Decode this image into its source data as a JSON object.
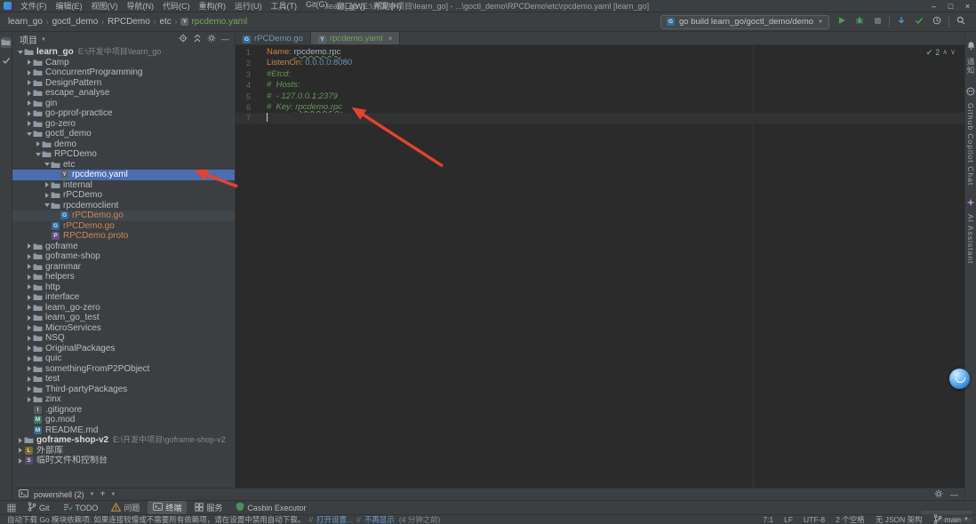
{
  "title_bar": {
    "menus": [
      "文件(F)",
      "编辑(E)",
      "视图(V)",
      "导航(N)",
      "代码(C)",
      "重构(R)",
      "运行(U)",
      "工具(T)",
      "Git(G)",
      "窗口(W)",
      "帮助(H)"
    ],
    "title": "learn_go [E:\\开发中项目\\learn_go] - ...\\goctl_demo\\RPCDemo\\etc\\rpcdemo.yaml [learn_go]",
    "window_buttons": [
      {
        "name": "minimize",
        "glyph": "–"
      },
      {
        "name": "maximize",
        "glyph": "□"
      },
      {
        "name": "close",
        "glyph": "×"
      }
    ]
  },
  "nav_bar": {
    "breadcrumbs": [
      "learn_go",
      "goctl_demo",
      "RPCDemo",
      "etc",
      "rpcdemo.yaml"
    ],
    "run_config": "go build learn_go/goctl_demo/demo",
    "toolbar_icons": [
      "run",
      "debug",
      "stop",
      "divider",
      "vcs-update",
      "vcs-commit",
      "history",
      "divider",
      "search"
    ]
  },
  "left_strip": {
    "buttons": [
      {
        "icon": "folder",
        "label": "project",
        "active": true
      },
      {
        "icon": "commit",
        "label": "commit",
        "active": false
      }
    ]
  },
  "right_strip": {
    "buttons": [
      {
        "icon": "bell",
        "label": "通知"
      },
      {
        "icon": "copilot",
        "label": "Github Copilot Chat"
      },
      {
        "icon": "ai-star",
        "label": "AI Assistant"
      }
    ]
  },
  "project_panel": {
    "title": "项目",
    "header_icons": [
      "locate",
      "collapse-all",
      "settings",
      "hide"
    ],
    "tree": [
      {
        "label": "learn_go",
        "ann": "E:\\开发中项目\\learn_go",
        "level": 0,
        "state": "expanded",
        "icon": "folder",
        "bold": true
      },
      {
        "label": "Camp",
        "level": 1,
        "state": "collapsed",
        "icon": "folder"
      },
      {
        "label": "ConcurrentProgramming",
        "level": 1,
        "state": "collapsed",
        "icon": "folder"
      },
      {
        "label": "DesignPattern",
        "level": 1,
        "state": "collapsed",
        "icon": "folder"
      },
      {
        "label": "escape_analyse",
        "level": 1,
        "state": "collapsed",
        "icon": "folder"
      },
      {
        "label": "gin",
        "level": 1,
        "state": "collapsed",
        "icon": "folder"
      },
      {
        "label": "go-pprof-practice",
        "level": 1,
        "state": "collapsed",
        "icon": "folder"
      },
      {
        "label": "go-zero",
        "level": 1,
        "state": "collapsed",
        "icon": "folder"
      },
      {
        "label": "goctl_demo",
        "level": 1,
        "state": "expanded",
        "icon": "folder"
      },
      {
        "label": "demo",
        "level": 2,
        "state": "collapsed",
        "icon": "folder"
      },
      {
        "label": "RPCDemo",
        "level": 2,
        "state": "expanded",
        "icon": "folder"
      },
      {
        "label": "etc",
        "level": 3,
        "state": "expanded",
        "icon": "folder"
      },
      {
        "label": "rpcdemo.yaml",
        "level": 4,
        "state": "leaf",
        "icon": "yaml",
        "bg": "selected",
        "color": "#ffffff"
      },
      {
        "label": "internal",
        "level": 3,
        "state": "collapsed",
        "icon": "folder"
      },
      {
        "label": "rPCDemo",
        "level": 3,
        "state": "collapsed",
        "icon": "folder"
      },
      {
        "label": "rpcdemoclient",
        "level": 3,
        "state": "expanded",
        "icon": "folder"
      },
      {
        "label": "rPCDemo.go",
        "level": 4,
        "state": "leaf",
        "icon": "go",
        "bg": "inactive",
        "color": "#c9885c"
      },
      {
        "label": "rPCDemo.go",
        "level": 3,
        "state": "leaf",
        "icon": "go",
        "color": "#c9885c"
      },
      {
        "label": "RPCDemo.proto",
        "level": 3,
        "state": "leaf",
        "icon": "proto",
        "color": "#c9885c"
      },
      {
        "label": "goframe",
        "level": 1,
        "state": "collapsed",
        "icon": "folder"
      },
      {
        "label": "goframe-shop",
        "level": 1,
        "state": "collapsed",
        "icon": "folder"
      },
      {
        "label": "grammar",
        "level": 1,
        "state": "collapsed",
        "icon": "folder"
      },
      {
        "label": "helpers",
        "level": 1,
        "state": "collapsed",
        "icon": "folder"
      },
      {
        "label": "http",
        "level": 1,
        "state": "collapsed",
        "icon": "folder"
      },
      {
        "label": "interface",
        "level": 1,
        "state": "collapsed",
        "icon": "folder"
      },
      {
        "label": "learn_go-zero",
        "level": 1,
        "state": "collapsed",
        "icon": "folder"
      },
      {
        "label": "learn_go_test",
        "level": 1,
        "state": "collapsed",
        "icon": "folder"
      },
      {
        "label": "MicroServices",
        "level": 1,
        "state": "collapsed",
        "icon": "folder"
      },
      {
        "label": "NSQ",
        "level": 1,
        "state": "collapsed",
        "icon": "folder"
      },
      {
        "label": "OriginalPackages",
        "level": 1,
        "state": "collapsed",
        "icon": "folder"
      },
      {
        "label": "quic",
        "level": 1,
        "state": "collapsed",
        "icon": "folder"
      },
      {
        "label": "somethingFromP2PObject",
        "level": 1,
        "state": "collapsed",
        "icon": "folder"
      },
      {
        "label": "test",
        "level": 1,
        "state": "collapsed",
        "icon": "folder"
      },
      {
        "label": "Third-partyPackages",
        "level": 1,
        "state": "collapsed",
        "icon": "folder"
      },
      {
        "label": "zinx",
        "level": 1,
        "state": "collapsed",
        "icon": "folder"
      },
      {
        "label": ".gitignore",
        "level": 1,
        "state": "leaf",
        "icon": "gitignore"
      },
      {
        "label": "go.mod",
        "level": 1,
        "state": "leaf",
        "icon": "gomod"
      },
      {
        "label": "README.md",
        "level": 1,
        "state": "leaf",
        "icon": "md"
      },
      {
        "label": "goframe-shop-v2",
        "ann": "E:\\开发中项目\\goframe-shop-v2",
        "level": 0,
        "state": "collapsed",
        "icon": "folder",
        "bold": true
      },
      {
        "label": "外部库",
        "level": 0,
        "state": "collapsed",
        "icon": "lib"
      },
      {
        "label": "临时文件和控制台",
        "level": 0,
        "state": "collapsed",
        "icon": "scratch"
      }
    ]
  },
  "editor": {
    "tabs": [
      {
        "label": "rPCDemo.go",
        "icon": "go",
        "color": "#6897bb",
        "active": false
      },
      {
        "label": "rpcdemo.yaml",
        "icon": "yaml",
        "color": "#73a25f",
        "active": true,
        "close": "×"
      }
    ],
    "inspection_count": "2",
    "lines": [
      {
        "no": "1",
        "tokens": [
          {
            "t": "Name:",
            "s": "key"
          },
          {
            "t": " ",
            "s": "plain"
          },
          {
            "t": "rpcdemo.rpc",
            "s": "plain underline"
          }
        ]
      },
      {
        "no": "2",
        "tokens": [
          {
            "t": "ListenOn:",
            "s": "key"
          },
          {
            "t": " ",
            "s": "plain"
          },
          {
            "t": "0.0.0.0:8080",
            "s": "num"
          }
        ]
      },
      {
        "no": "3",
        "tokens": [
          {
            "t": "#Etcd:",
            "s": "comment"
          }
        ]
      },
      {
        "no": "4",
        "tokens": [
          {
            "t": "#  Hosts:",
            "s": "comment"
          }
        ]
      },
      {
        "no": "5",
        "tokens": [
          {
            "t": "#  - 127.0.0.1:2379",
            "s": "comment"
          }
        ]
      },
      {
        "no": "6",
        "tokens": [
          {
            "t": "#  Key: ",
            "s": "comment"
          },
          {
            "t": "rpcdemo.rpc",
            "s": "comment underline"
          }
        ]
      },
      {
        "no": "7",
        "tokens": [],
        "caret": true
      }
    ]
  },
  "terminal_bar": {
    "tab_label": "powershell (2)",
    "new_tab": "+",
    "right_icons": [
      "settings",
      "minimize"
    ]
  },
  "tool_window_bar": {
    "items": [
      {
        "label": "Git",
        "icon": "git-branch",
        "active": false
      },
      {
        "label": "TODO",
        "icon": "todo",
        "active": false
      },
      {
        "label": "问题",
        "icon": "problems",
        "active": false
      },
      {
        "label": "终端",
        "icon": "terminal",
        "active": true
      },
      {
        "label": "服务",
        "icon": "services",
        "active": false
      },
      {
        "label": "Casbin Executor",
        "icon": "casbin",
        "active": false
      }
    ]
  },
  "status_bar": {
    "message": "自动下载 Go 模块依赖项: 如果连接较慢或不需要所有依赖项，请在设置中禁用自动下载。",
    "actions": [
      "打开设置...",
      "不再显示"
    ],
    "timestamp": "(4 分钟之前)",
    "segments": [
      "7:1",
      "LF",
      "UTF-8",
      "2 个空格",
      "无 JSON 架构"
    ],
    "branch": "main"
  },
  "colors": {
    "selection_blue": "#4b6eaf",
    "arrow_red": "#e5432e",
    "accent_green": "#499c54",
    "comment_green": "#629755",
    "yaml_key_orange": "#cc8242"
  }
}
